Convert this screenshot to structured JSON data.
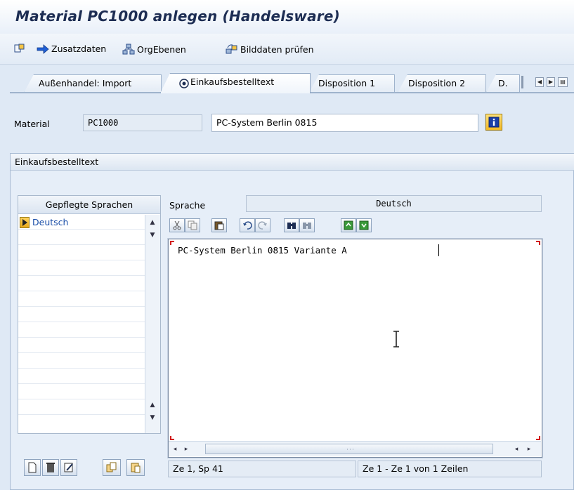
{
  "window": {
    "title": "Material PC1000 anlegen (Handelsware)"
  },
  "toolbar": {
    "items": [
      {
        "icon": "other-view-icon",
        "label": ""
      },
      {
        "icon": "arrow-right-icon",
        "label": "Zusatzdaten"
      },
      {
        "icon": "org-levels-icon",
        "label": "OrgEbenen"
      },
      {
        "icon": "check-screen-data-icon",
        "label": "Bilddaten prüfen"
      }
    ]
  },
  "tabs": [
    {
      "label": "Außenhandel: Import",
      "active": false
    },
    {
      "label": "Einkaufsbestelltext",
      "active": true,
      "icon": "tab-active-icon"
    },
    {
      "label": "Disposition 1",
      "active": false
    },
    {
      "label": "Disposition 2",
      "active": false
    },
    {
      "label": "D.",
      "active": false
    }
  ],
  "header": {
    "material_label": "Material",
    "material_value": "PC1000",
    "description_value": "PC-System Berlin 0815",
    "info_icon": "info-icon"
  },
  "group": {
    "title": "Einkaufsbestelltext"
  },
  "languages": {
    "header": "Gepflegte Sprachen",
    "items": [
      "Deutsch"
    ]
  },
  "editor": {
    "language_label": "Sprache",
    "language_value": "Deutsch",
    "text": "PC-System Berlin 0815 Variante A",
    "toolbar_icons": [
      "cut-icon",
      "copy-icon",
      "paste-icon",
      "undo-icon",
      "redo-icon",
      "find-icon",
      "find-next-icon",
      "upload-icon",
      "download-icon"
    ]
  },
  "status": {
    "position": "Ze 1, Sp 41",
    "lines": "Ze 1 - Ze 1 von 1 Zeilen"
  },
  "bottom_buttons": [
    "new-text-icon",
    "delete-text-icon",
    "edit-text-icon",
    "copy-text-icon",
    "paste-text-icon"
  ],
  "colors": {
    "title": "#1d2d53",
    "background": "#dfe9f5",
    "accent_red": "#d21e1e",
    "link_blue": "#1a4ea8"
  }
}
